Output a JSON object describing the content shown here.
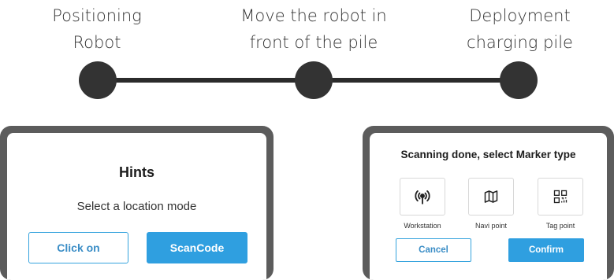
{
  "steps": [
    {
      "line1": "Positioning",
      "line2": "Robot"
    },
    {
      "line1": "Move the robot in",
      "line2": "front of the pile"
    },
    {
      "line1": "Deployment",
      "line2": "charging pile"
    }
  ],
  "hints_dialog": {
    "title": "Hints",
    "message": "Select a location mode",
    "click_on_label": "Click on",
    "scancode_label": "ScanCode"
  },
  "marker_dialog": {
    "title": "Scanning done, select Marker type",
    "options": [
      {
        "label": "Workstation",
        "icon": "signal-tower-icon"
      },
      {
        "label": "Navi point",
        "icon": "map-icon"
      },
      {
        "label": "Tag point",
        "icon": "qr-code-icon"
      }
    ],
    "cancel_label": "Cancel",
    "confirm_label": "Confirm"
  },
  "colors": {
    "accent": "#2f9fe0",
    "step_node": "#333333",
    "frame": "#5c5c5c"
  }
}
